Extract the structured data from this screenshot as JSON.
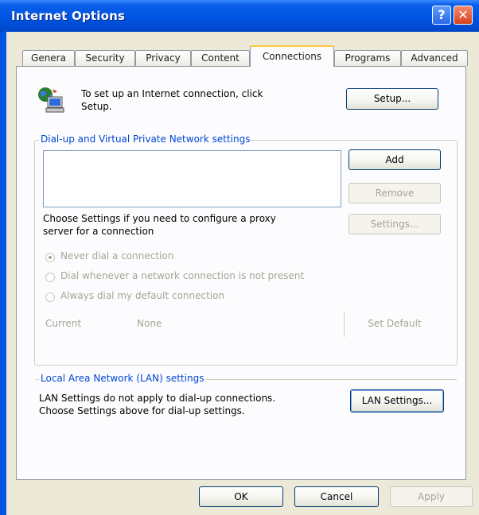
{
  "window": {
    "title": "Internet Options",
    "help_glyph": "?",
    "close_glyph": "✕"
  },
  "tabs": [
    {
      "label": "Genera"
    },
    {
      "label": "Security"
    },
    {
      "label": "Privacy"
    },
    {
      "label": "Content"
    },
    {
      "label": "Connections"
    },
    {
      "label": "Programs"
    },
    {
      "label": "Advanced"
    }
  ],
  "active_tab": "Connections",
  "setup": {
    "text_line1": "To set up an Internet connection, click",
    "text_line2": "Setup.",
    "button": "Setup..."
  },
  "dialup": {
    "group_label": "Dial-up and Virtual Private Network settings",
    "add_button": "Add",
    "remove_button": "Remove",
    "settings_button": "Settings...",
    "proxy_text_line1": "Choose Settings if you need to configure a proxy",
    "proxy_text_line2": "server for a connection",
    "radios": [
      {
        "label": "Never dial a connection",
        "checked": true
      },
      {
        "label": "Dial whenever a network connection is not present",
        "checked": false
      },
      {
        "label": "Always dial my default connection",
        "checked": false
      }
    ],
    "current_label": "Current",
    "current_value": "None",
    "set_default_button": "Set Default"
  },
  "lan": {
    "group_label": "Local Area Network (LAN) settings",
    "text_line1": "LAN Settings do not apply to dial-up connections.",
    "text_line2": "Choose Settings above for dial-up settings.",
    "button": "LAN Settings..."
  },
  "footer": {
    "ok": "OK",
    "cancel": "Cancel",
    "apply": "Apply"
  }
}
